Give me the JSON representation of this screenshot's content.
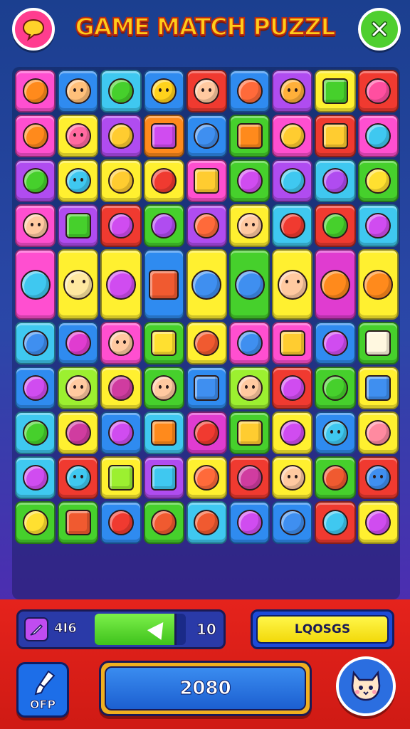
{
  "header": {
    "title": "GAME MATCH PUZZL",
    "chat_icon": "chat-bubble-icon",
    "close_icon": "close-x-icon"
  },
  "colors": {
    "pink": "#ff4fd0",
    "blue": "#2f8bf0",
    "cyan": "#3fc8f0",
    "red": "#f03a30",
    "yellow": "#fff030",
    "green": "#46d02c",
    "purple": "#b04cf0",
    "orange": "#ff8a1c",
    "lime": "#9cf030",
    "magenta": "#e03cd0"
  },
  "board": {
    "rows": [
      [
        {
          "c": "pink",
          "i": "planet",
          "ic": "#ff8a1c"
        },
        {
          "c": "blue",
          "i": "face",
          "ic": "#ffc07a"
        },
        {
          "c": "cyan",
          "i": "blob",
          "ic": "#46d02c"
        },
        {
          "c": "blue",
          "i": "face",
          "ic": "#ffd21c"
        },
        {
          "c": "red",
          "i": "face",
          "ic": "#ffc9a0"
        },
        {
          "c": "blue",
          "i": "tool",
          "ic": "#ff6a3a"
        },
        {
          "c": "purple",
          "i": "face",
          "ic": "#ffb03a"
        },
        {
          "c": "yellow",
          "i": "cube",
          "ic": "#46d02c"
        },
        {
          "c": "red",
          "i": "ring",
          "ic": "#ff4fa0"
        }
      ],
      [
        {
          "c": "pink",
          "i": "fruit",
          "ic": "#ff8a1c"
        },
        {
          "c": "yellow",
          "i": "face",
          "ic": "#ff6aa0"
        },
        {
          "c": "purple",
          "i": "sun",
          "ic": "#ffcc30"
        },
        {
          "c": "orange",
          "i": "box",
          "ic": "#d04cf0"
        },
        {
          "c": "blue",
          "i": "bowl",
          "ic": "#3f8ff0"
        },
        {
          "c": "green",
          "i": "bar",
          "ic": "#ff8a1c"
        },
        {
          "c": "pink",
          "i": "key",
          "ic": "#ffcc30"
        },
        {
          "c": "red",
          "i": "frame",
          "ic": "#ffcc30"
        },
        {
          "c": "pink",
          "i": "pen",
          "ic": "#3fc8f0"
        }
      ],
      [
        {
          "c": "purple",
          "i": "fruit",
          "ic": "#46d02c"
        },
        {
          "c": "yellow",
          "i": "face",
          "ic": "#3fc8f0"
        },
        {
          "c": "yellow",
          "i": "ring",
          "ic": "#ffcc30"
        },
        {
          "c": "yellow",
          "i": "fruit",
          "ic": "#f03a30"
        },
        {
          "c": "pink",
          "i": "box",
          "ic": "#ffcc30"
        },
        {
          "c": "green",
          "i": "bottle",
          "ic": "#d04cf0"
        },
        {
          "c": "purple",
          "i": "jar",
          "ic": "#3fc8f0"
        },
        {
          "c": "cyan",
          "i": "pen",
          "ic": "#b04cf0"
        },
        {
          "c": "green",
          "i": "fruit",
          "ic": "#ffe030"
        }
      ],
      [
        {
          "c": "pink",
          "i": "face",
          "ic": "#ffc9a0"
        },
        {
          "c": "purple",
          "i": "frame",
          "ic": "#46d02c"
        },
        {
          "c": "red",
          "i": "drop",
          "ic": "#d04cf0"
        },
        {
          "c": "green",
          "i": "leaf",
          "ic": "#b04cf0"
        },
        {
          "c": "purple",
          "i": "gear",
          "ic": "#ff6a3a"
        },
        {
          "c": "yellow",
          "i": "face",
          "ic": "#ffc9a0"
        },
        {
          "c": "cyan",
          "i": "blob",
          "ic": "#f03a30"
        },
        {
          "c": "red",
          "i": "jar",
          "ic": "#46d02c"
        },
        {
          "c": "cyan",
          "i": "bottle",
          "ic": "#d04cf0"
        }
      ],
      [
        {
          "c": "pink",
          "i": "gear",
          "ic": "#3fc8f0"
        },
        {
          "c": "yellow",
          "i": "face",
          "ic": "#ffe8a0"
        },
        {
          "c": "yellow",
          "i": "fruit",
          "ic": "#d04cf0"
        },
        {
          "c": "blue",
          "i": "tag",
          "ic": "#f05a30"
        },
        {
          "c": "yellow",
          "i": "bottle",
          "ic": "#3f8ff0"
        },
        {
          "c": "green",
          "i": "jar",
          "ic": "#3f8ff0"
        },
        {
          "c": "yellow",
          "i": "face",
          "ic": "#ffc9a0"
        },
        {
          "c": "magenta",
          "i": "tool",
          "ic": "#ff8a1c"
        },
        {
          "c": "yellow",
          "i": "fruit",
          "ic": "#ff8a1c"
        }
      ],
      [
        {
          "c": "cyan",
          "i": "ring",
          "ic": "#3f8ff0"
        },
        {
          "c": "blue",
          "i": "bottle",
          "ic": "#e03cd0"
        },
        {
          "c": "pink",
          "i": "face",
          "ic": "#ffc9a0"
        },
        {
          "c": "green",
          "i": "book",
          "ic": "#ffe030"
        },
        {
          "c": "yellow",
          "i": "bag",
          "ic": "#f05a30"
        },
        {
          "c": "pink",
          "i": "gear",
          "ic": "#3f8ff0"
        },
        {
          "c": "pink",
          "i": "bar",
          "ic": "#ffcc30"
        },
        {
          "c": "blue",
          "i": "drop",
          "ic": "#d04cf0"
        },
        {
          "c": "green",
          "i": "book",
          "ic": "#fff8e0"
        }
      ],
      [
        {
          "c": "blue",
          "i": "blob",
          "ic": "#d04cf0"
        },
        {
          "c": "lime",
          "i": "face",
          "ic": "#ffc9a0"
        },
        {
          "c": "yellow",
          "i": "rose",
          "ic": "#d03ca0"
        },
        {
          "c": "green",
          "i": "face",
          "ic": "#ffc9a0"
        },
        {
          "c": "blue",
          "i": "frame",
          "ic": "#3f8ff0"
        },
        {
          "c": "lime",
          "i": "face",
          "ic": "#ffc9a0"
        },
        {
          "c": "red",
          "i": "drop",
          "ic": "#d04cf0"
        },
        {
          "c": "green",
          "i": "leaf",
          "ic": "#46d02c"
        },
        {
          "c": "yellow",
          "i": "cube",
          "ic": "#3f8ff0"
        }
      ],
      [
        {
          "c": "cyan",
          "i": "jar",
          "ic": "#46d02c"
        },
        {
          "c": "yellow",
          "i": "rose",
          "ic": "#d03ca0"
        },
        {
          "c": "blue",
          "i": "pen",
          "ic": "#d04cf0"
        },
        {
          "c": "cyan",
          "i": "cube",
          "ic": "#ff8a1c"
        },
        {
          "c": "magenta",
          "i": "blob",
          "ic": "#f03a30"
        },
        {
          "c": "green",
          "i": "box",
          "ic": "#ffcc30"
        },
        {
          "c": "yellow",
          "i": "ring",
          "ic": "#d04cf0"
        },
        {
          "c": "blue",
          "i": "face",
          "ic": "#3fc8f0"
        },
        {
          "c": "yellow",
          "i": "jar",
          "ic": "#ff8aa0"
        }
      ],
      [
        {
          "c": "cyan",
          "i": "bell",
          "ic": "#d04cf0"
        },
        {
          "c": "red",
          "i": "face",
          "ic": "#3fc8f0"
        },
        {
          "c": "yellow",
          "i": "book",
          "ic": "#9cf030"
        },
        {
          "c": "purple",
          "i": "frame",
          "ic": "#3fc8f0"
        },
        {
          "c": "yellow",
          "i": "gear",
          "ic": "#ff6a3a"
        },
        {
          "c": "red",
          "i": "gear",
          "ic": "#d03ca0"
        },
        {
          "c": "yellow",
          "i": "face",
          "ic": "#ffc9a0"
        },
        {
          "c": "green",
          "i": "fruit",
          "ic": "#f05a30"
        },
        {
          "c": "red",
          "i": "face",
          "ic": "#3f8ff0"
        }
      ],
      [
        {
          "c": "green",
          "i": "blob",
          "ic": "#ffe030"
        },
        {
          "c": "green",
          "i": "box",
          "ic": "#f05a30"
        },
        {
          "c": "blue",
          "i": "eye",
          "ic": "#f03a30"
        },
        {
          "c": "green",
          "i": "tool",
          "ic": "#f05a30"
        },
        {
          "c": "cyan",
          "i": "fruit",
          "ic": "#f05a30"
        },
        {
          "c": "blue",
          "i": "drop",
          "ic": "#d04cf0"
        },
        {
          "c": "blue",
          "i": "gear",
          "ic": "#3f8ff0"
        },
        {
          "c": "red",
          "i": "gear",
          "ic": "#3fc8f0"
        },
        {
          "c": "yellow",
          "i": "ring",
          "ic": "#d04cf0"
        }
      ]
    ]
  },
  "status": {
    "score_left": "4I6",
    "moves": "10",
    "progress_fraction": 0.9,
    "level_label": "LQOSGS",
    "off_label": "OFP",
    "total_score": "2080",
    "cat_icon": "cat-face-icon"
  }
}
